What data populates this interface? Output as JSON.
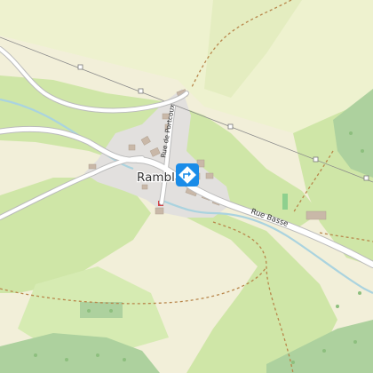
{
  "map": {
    "place_label": "Rambl",
    "streets": {
      "rue_basse": "Rue Basse",
      "rue_de_portcoux": "Rue de Portcoux"
    },
    "marker_icon": "turn-right-diamond-icon",
    "colors": {
      "land": "#f2efd9",
      "meadow": "#e8efc3",
      "grass": "#cde8a9",
      "forest": "#add19e",
      "residential": "#e0dfdf",
      "building": "#c9b8a8",
      "road": "#ffffff",
      "road_casing": "#bbbbbb",
      "track": "#b8864b",
      "power_line": "#8a8a8a",
      "water": "#aad3df",
      "marker": "#1a8ce8"
    }
  }
}
